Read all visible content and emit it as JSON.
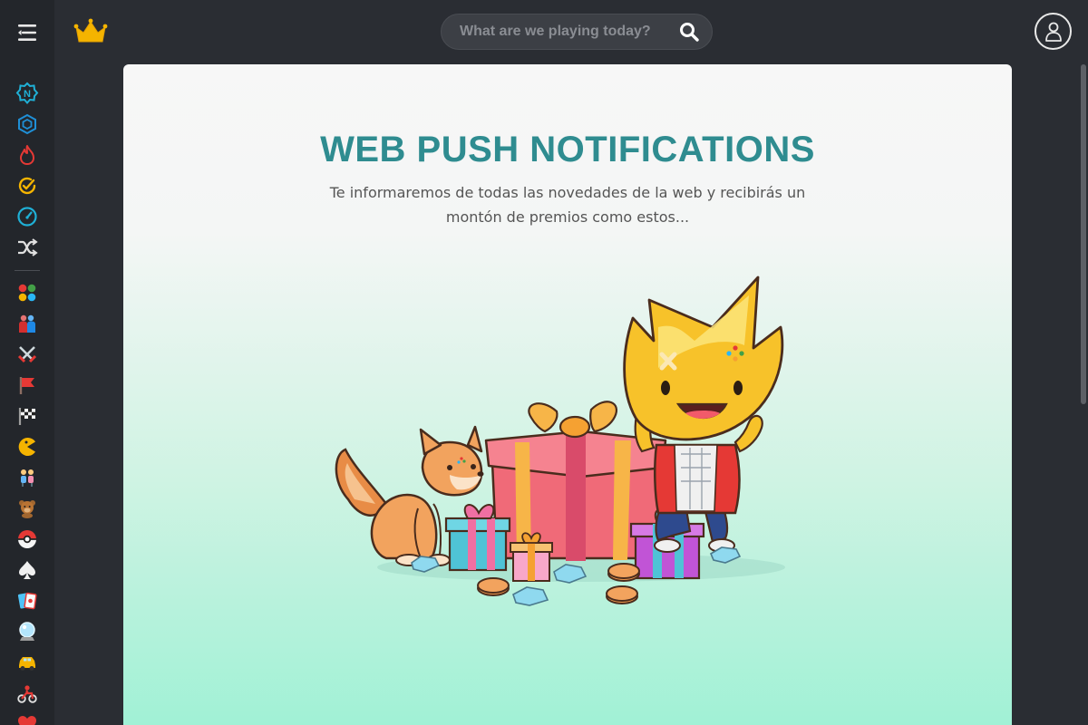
{
  "header": {
    "search_placeholder": "What are we playing today?"
  },
  "sidebar": {
    "items": [
      {
        "icon": "new-icon",
        "color": "#1fb0d6"
      },
      {
        "icon": "hexagon-icon",
        "color": "#1f8fd6"
      },
      {
        "icon": "fire-icon",
        "color": "#e53935"
      },
      {
        "icon": "check-refresh-icon",
        "color": "#f5b400"
      },
      {
        "icon": "gauge-icon",
        "color": "#1fb0d6"
      },
      {
        "icon": "shuffle-icon",
        "color": "#e0e0e0"
      },
      {
        "icon": "dots-grid-icon",
        "color": "#e53935"
      },
      {
        "icon": "fighters-icon",
        "color": "#d32f2f"
      },
      {
        "icon": "crossed-swords-icon",
        "color": "#9e9e9e"
      },
      {
        "icon": "red-flag-icon",
        "color": "#e53935"
      },
      {
        "icon": "checkered-flag-icon",
        "color": "#f0f0f0"
      },
      {
        "icon": "pacman-icon",
        "color": "#f5b400"
      },
      {
        "icon": "two-people-icon",
        "color": "#64b5f6"
      },
      {
        "icon": "teddy-bear-icon",
        "color": "#a1662f"
      },
      {
        "icon": "pokeball-icon",
        "color": "#e53935"
      },
      {
        "icon": "spade-icon",
        "color": "#f0f0f0"
      },
      {
        "icon": "cards-icon",
        "color": "#4fc3f7"
      },
      {
        "icon": "crystal-ball-icon",
        "color": "#b3e5fc"
      },
      {
        "icon": "car-icon",
        "color": "#f5b400"
      },
      {
        "icon": "motorbike-icon",
        "color": "#e53935"
      },
      {
        "icon": "heart-icon",
        "color": "#e53935"
      }
    ]
  },
  "main": {
    "title": "WEB PUSH NOTIFICATIONS",
    "subtitle": "Te informaremos de todas las novedades de la web y recibirás un montón de premios como estos..."
  },
  "colors": {
    "accent": "#2f8c90",
    "brand": "#f5b400",
    "background": "#2a2d33"
  }
}
